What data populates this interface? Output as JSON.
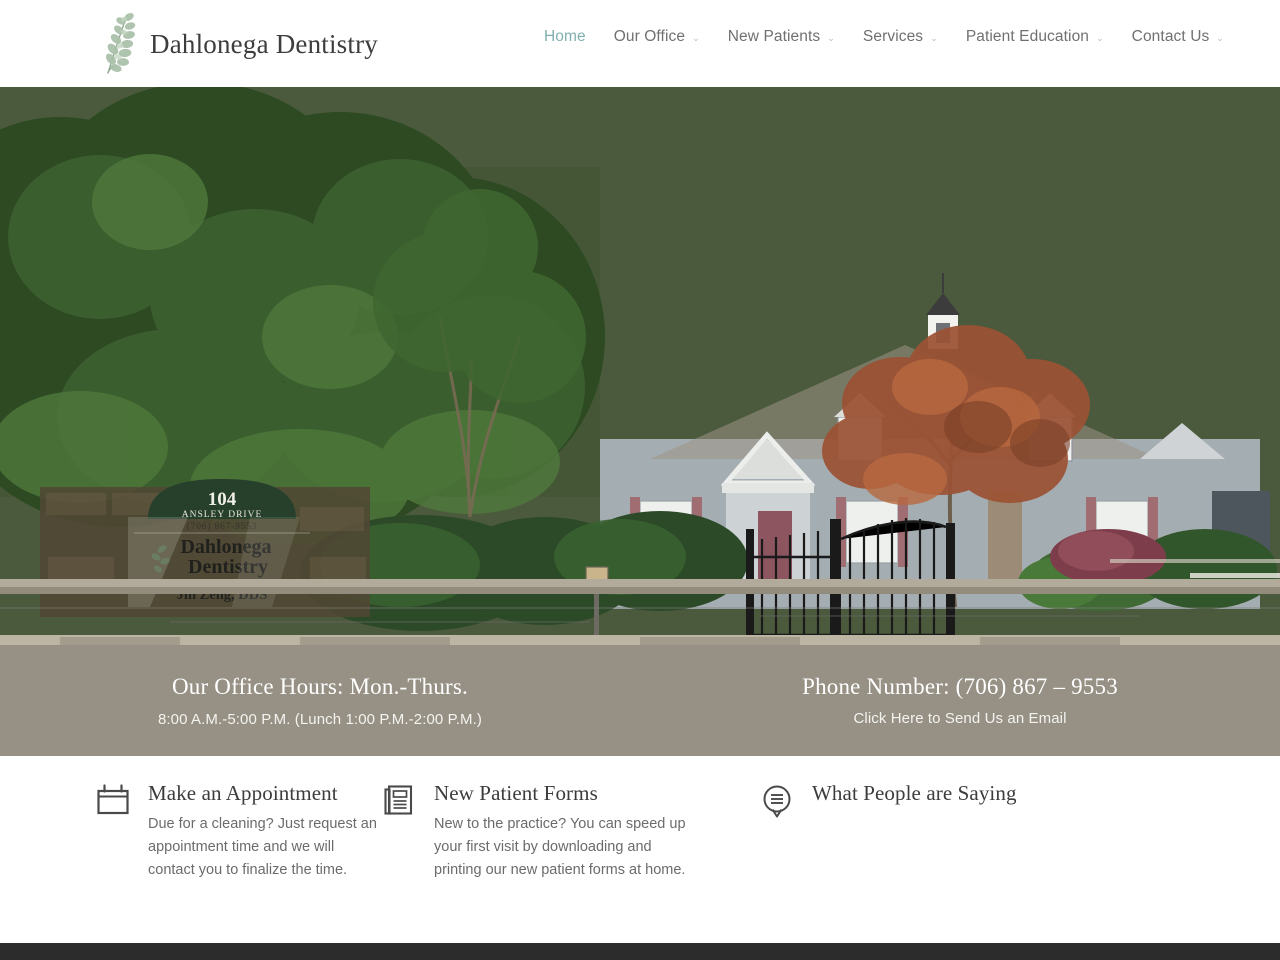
{
  "header": {
    "logo": {
      "icon": "leaf-branch-icon",
      "wordmark": "Dahlonega Dentistry"
    },
    "nav": [
      {
        "label": "Home",
        "active": true,
        "has_dropdown": false,
        "caret": ""
      },
      {
        "label": "Our Office",
        "active": false,
        "has_dropdown": true,
        "caret": "⌄"
      },
      {
        "label": "New Patients",
        "active": false,
        "has_dropdown": true,
        "caret": "⌄"
      },
      {
        "label": "Services",
        "active": false,
        "has_dropdown": true,
        "caret": "⌄"
      },
      {
        "label": "Patient Education",
        "active": false,
        "has_dropdown": true,
        "caret": "⌄"
      },
      {
        "label": "Contact Us",
        "active": false,
        "has_dropdown": true,
        "caret": "⌄"
      }
    ]
  },
  "hero": {
    "alt": "Dahlonega Dentistry office building with monument sign",
    "monument_sign": {
      "street_number": "104",
      "street_name": "ANSLEY DRIVE",
      "phone": "(706) 867-9553",
      "practice_line1": "Dahlonega",
      "practice_line2": "Dentistry",
      "doctor": "Jin Zeng, DDS"
    }
  },
  "info_band": {
    "background": "#969184",
    "hours": {
      "heading": "Our Office Hours: Mon.-Thurs.",
      "detail": "8:00 A.M.-5:00 P.M. (Lunch 1:00 P.M.-2:00 P.M.)"
    },
    "phone": {
      "heading": "Phone Number: (706) 867 – 9553",
      "email_link": "Click Here to Send Us an Email"
    }
  },
  "features": [
    {
      "icon": "calendar-icon",
      "title": "Make an Appointment",
      "text": "Due for a cleaning? Just request an appointment time and we will contact you to finalize the time."
    },
    {
      "icon": "documents-icon",
      "title": "New Patient Forms",
      "text": "New to the practice? You can speed up your first visit by downloading and printing our new patient forms at home."
    },
    {
      "icon": "speech-bubble-icon",
      "title": "What People are Saying",
      "text": ""
    }
  ],
  "theme": {
    "accent_teal": "#7fb0ae",
    "band_tan": "#969184",
    "nav_text": "#707070",
    "heading_dark": "#3c3c3c",
    "body_gray": "#6b6b6b",
    "footer_dark": "#2c2c2c"
  }
}
